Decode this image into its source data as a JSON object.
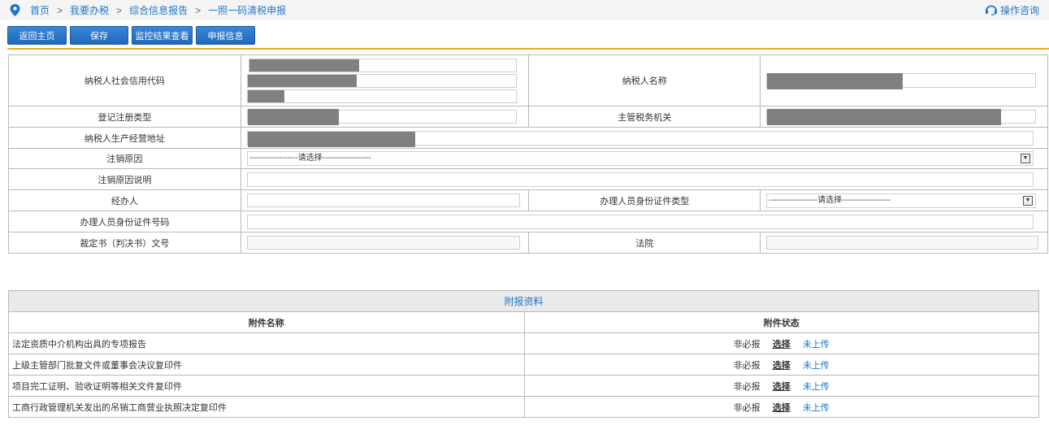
{
  "breadcrumb": {
    "items": [
      "首页",
      "我要办税",
      "综合信息报告",
      "一照一码清税申报"
    ],
    "separator": ">"
  },
  "help_label": "操作咨询",
  "toolbar": {
    "back_label": "返回主页",
    "save_label": "保存",
    "monitor_label": "监控结果查看",
    "declare_label": "申报信息"
  },
  "form": {
    "credit_code_label": "纳税人社会信用代码",
    "taxpayer_name_label": "纳税人名称",
    "reg_type_label": "登记注册类型",
    "tax_authority_label": "主管税务机关",
    "address_label": "纳税人生产经营地址",
    "cancel_reason_label": "注销原因",
    "cancel_reason_value": "------------------请选择------------------",
    "cancel_desc_label": "注销原因说明",
    "agent_label": "经办人",
    "id_type_label": "办理人员身份证件类型",
    "id_type_value": "------------------请选择------------------",
    "id_no_label": "办理人员身份证件号码",
    "ruling_label": "裁定书（判决书）文号",
    "court_label": "法院"
  },
  "attachments": {
    "title": "附报资料",
    "col_name": "附件名称",
    "col_status": "附件状态",
    "rows": [
      {
        "name": "法定资质中介机构出具的专项报告",
        "required": "非必报",
        "action": "选择",
        "status": "未上传"
      },
      {
        "name": "上级主管部门批复文件或董事会决议复印件",
        "required": "非必报",
        "action": "选择",
        "status": "未上传"
      },
      {
        "name": "项目完工证明、验收证明等相关文件复印件",
        "required": "非必报",
        "action": "选择",
        "status": "未上传"
      },
      {
        "name": "工商行政管理机关发出的吊销工商营业执照决定复印件",
        "required": "非必报",
        "action": "选择",
        "status": "未上传"
      }
    ]
  },
  "colors": {
    "link": "#1f76c8",
    "button": "#2a74c9",
    "accent_line": "#f0a52a",
    "redaction": "#808080"
  }
}
